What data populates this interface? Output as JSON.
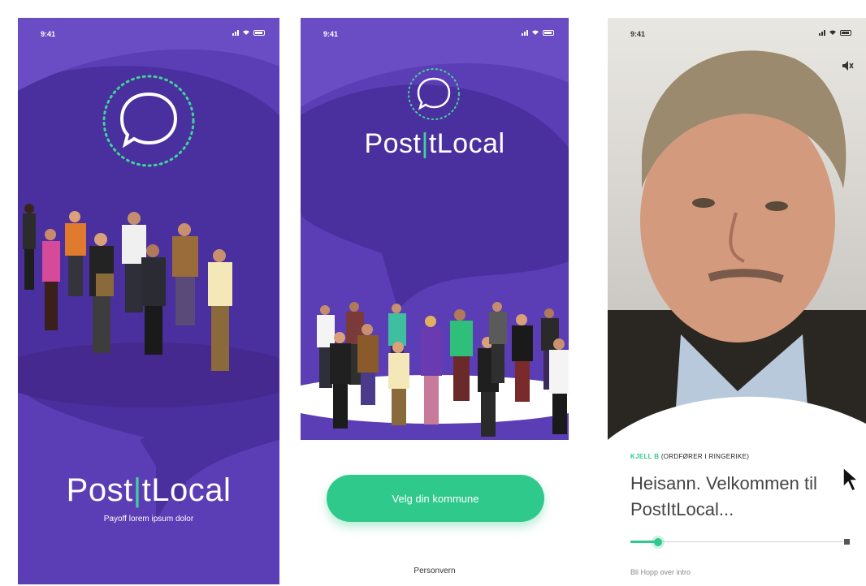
{
  "status_bar": {
    "time": "9:41"
  },
  "colors": {
    "brand_purple": "#5b3db5",
    "accent_green": "#2fc98c"
  },
  "screen1": {
    "logo_left": "Post",
    "logo_bar": "|",
    "logo_right": "tLocal",
    "tagline": "Payoff lorem ipsum dolor",
    "icon": "chat-bubble-icon"
  },
  "screen2": {
    "logo_left": "Post",
    "logo_bar": "|",
    "logo_right": "tLocal",
    "cta_label": "Velg din kommune",
    "link_label": "Personvern",
    "icon": "chat-bubble-icon"
  },
  "screen3": {
    "speaker_name": "KJELL B",
    "speaker_title": "(ORDFØRER I RINGERIKE)",
    "message_line1": "Heisann. Velkommen til",
    "message_line2": "PostItLocal...",
    "audio_progress": 0.13,
    "footnote": "Bli Hopp over intro",
    "icons": [
      "speaker-icon",
      "cursor-icon",
      "stop-icon"
    ]
  }
}
